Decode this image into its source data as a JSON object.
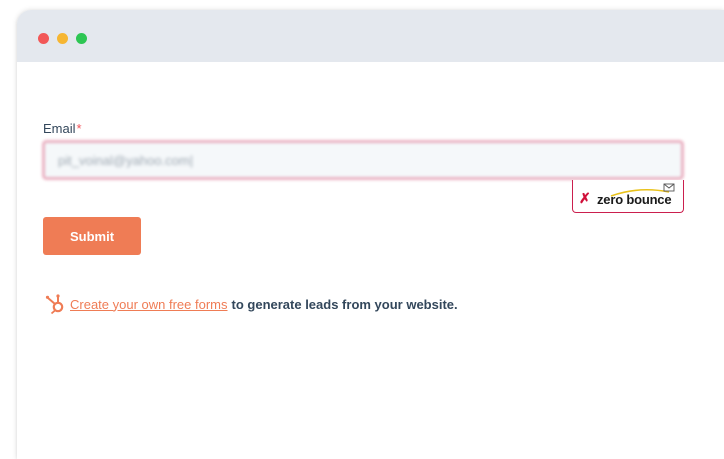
{
  "form": {
    "email_label": "Email",
    "required_marker": "*",
    "email_value": "pit_voinal@yahoo.com|",
    "submit_label": "Submit"
  },
  "validator_badge": {
    "status_mark": "✗",
    "brand_name": "zero bounce",
    "icon": "envelope-icon"
  },
  "promo": {
    "link_text": "Create your own free forms",
    "rest_text": "to generate leads from your website.",
    "icon": "hubspot-sprocket-icon"
  },
  "colors": {
    "accent": "#ef7c55",
    "error_border": "#cb1f4e",
    "text": "#33475b",
    "titlebar": "#e4e8ee",
    "traffic_red": "#f25757",
    "traffic_yellow": "#f6b632",
    "traffic_green": "#2dc653"
  }
}
